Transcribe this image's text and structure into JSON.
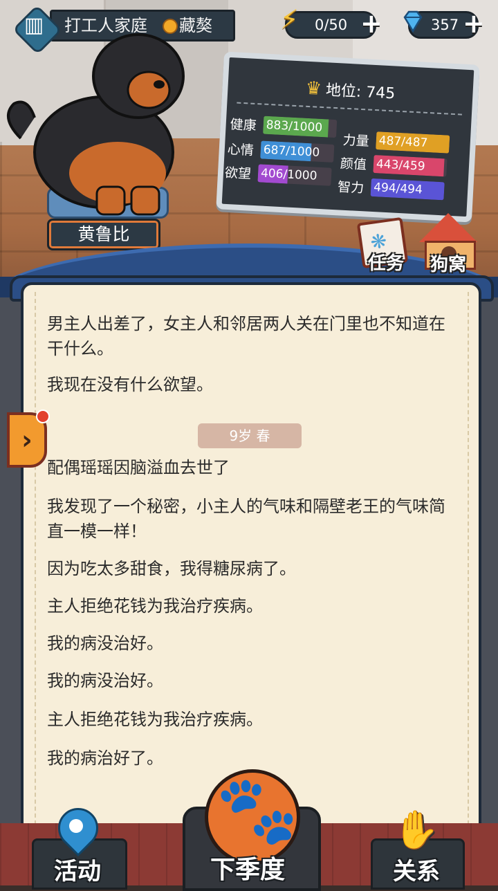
{
  "header": {
    "family_name": "打工人家庭",
    "breed": "藏獒",
    "energy": "0/50",
    "gems": "357"
  },
  "pet": {
    "name": "黄鲁比"
  },
  "stats": {
    "status_label": "地位: 745",
    "items": [
      {
        "label": "健康",
        "value": "883/1000",
        "fraction": 0.883,
        "color": "#5ba84e"
      },
      {
        "label": "力量",
        "value": "487/487",
        "fraction": 1.0,
        "color": "#e0a024"
      },
      {
        "label": "心情",
        "value": "687/1000",
        "fraction": 0.687,
        "color": "#3f8fd6"
      },
      {
        "label": "颜值",
        "value": "443/459",
        "fraction": 0.965,
        "color": "#d9466b"
      },
      {
        "label": "欲望",
        "value": "406/1000",
        "fraction": 0.406,
        "color": "#a24ad0"
      },
      {
        "label": "智力",
        "value": "494/494",
        "fraction": 1.0,
        "color": "#5a54d6"
      }
    ]
  },
  "side_buttons": {
    "task": "任务",
    "kennel": "狗窝"
  },
  "log": {
    "before": [
      "男主人出差了，女主人和邻居两人关在门里也不知道在干什么。",
      "我现在没有什么欲望。"
    ],
    "season": "9岁 春",
    "after": [
      "配偶瑶瑶因脑溢血去世了",
      "我发现了一个秘密，小主人的气味和隔壁老王的气味简直一模一样！",
      "因为吃太多甜食，我得糖尿病了。",
      "主人拒绝花钱为我治疗疾病。",
      "我的病没治好。",
      "我的病没治好。",
      "主人拒绝花钱为我治疗疾病。",
      "我的病治好了。"
    ]
  },
  "nav": {
    "activity": "活动",
    "next_season": "下季度",
    "relations": "关系"
  }
}
